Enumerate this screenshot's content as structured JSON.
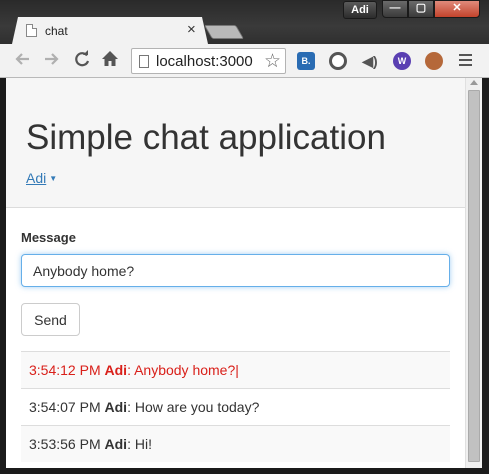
{
  "window": {
    "user_badge": "Adi",
    "min_glyph": "—",
    "max_glyph": "▢",
    "close_glyph": "✕"
  },
  "browser": {
    "tab_title": "chat",
    "tab_close": "×",
    "url": "localhost:3000"
  },
  "page": {
    "title": "Simple chat application",
    "user_menu_label": "Adi",
    "message_label": "Message",
    "message_value": "Anybody home?",
    "send_label": "Send"
  },
  "messages": [
    {
      "time": "3:54:12 PM",
      "author": "Adi",
      "sep": ": ",
      "text": "Anybody home?",
      "highlight": true
    },
    {
      "time": "3:54:07 PM",
      "author": "Adi",
      "sep": ": ",
      "text": "How are you today?",
      "highlight": false
    },
    {
      "time": "3:53:56 PM",
      "author": "Adi",
      "sep": ": ",
      "text": "Hi!",
      "highlight": false
    }
  ],
  "colors": {
    "link": "#337ab7",
    "highlight_message": "#d9201a",
    "input_focus": "#66afe9"
  },
  "icons": [
    "back-icon",
    "forward-icon",
    "reload-icon",
    "home-icon",
    "page-icon",
    "bookmark-star-icon",
    "menu-icon"
  ]
}
